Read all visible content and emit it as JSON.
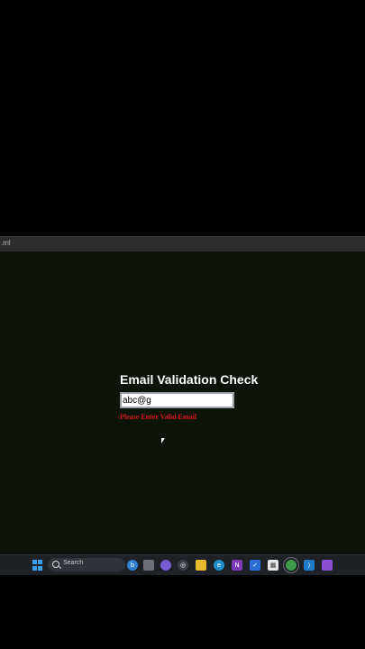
{
  "browser": {
    "url_fragment": ".ml"
  },
  "form": {
    "title": "Email Validation Check",
    "email_value": "abc@g",
    "error": "Please Enter Valid Email"
  },
  "taskbar": {
    "search_label": "Search",
    "icons": [
      "windows-start-icon",
      "search-icon",
      "copilot-icon",
      "task-view-icon",
      "chat-icon",
      "widget-icon",
      "file-explorer-icon",
      "edge-icon",
      "store-icon",
      "onenote-icon",
      "todo-icon",
      "calendar-icon",
      "chrome-icon",
      "vscode-icon",
      "app-icon"
    ]
  }
}
